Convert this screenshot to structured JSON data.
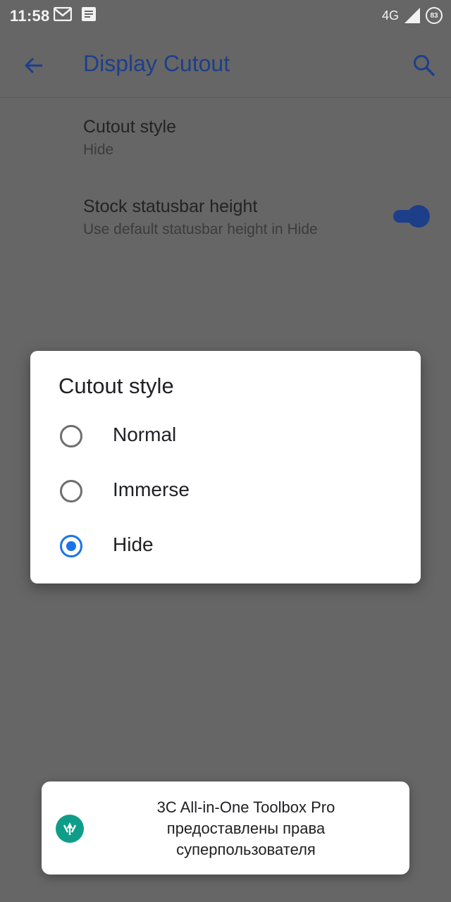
{
  "status_bar": {
    "time": "11:58",
    "network": "4G",
    "battery": "83"
  },
  "app_bar": {
    "title": "Display Cutout"
  },
  "preferences": [
    {
      "title": "Cutout style",
      "summary": "Hide"
    },
    {
      "title": "Stock statusbar height",
      "summary": "Use default statusbar height in Hide",
      "toggle_on": true
    }
  ],
  "dialog": {
    "title": "Cutout style",
    "options": [
      {
        "label": "Normal",
        "selected": false
      },
      {
        "label": "Immerse",
        "selected": false
      },
      {
        "label": "Hide",
        "selected": true
      }
    ]
  },
  "toast": {
    "lines": [
      "3C All-in-One Toolbox Pro",
      "предоставлены права",
      "суперпользователя"
    ]
  },
  "colors": {
    "accent": "#1a73e8",
    "appbar_text": "#1d3f8a",
    "scrim": "#666666"
  }
}
